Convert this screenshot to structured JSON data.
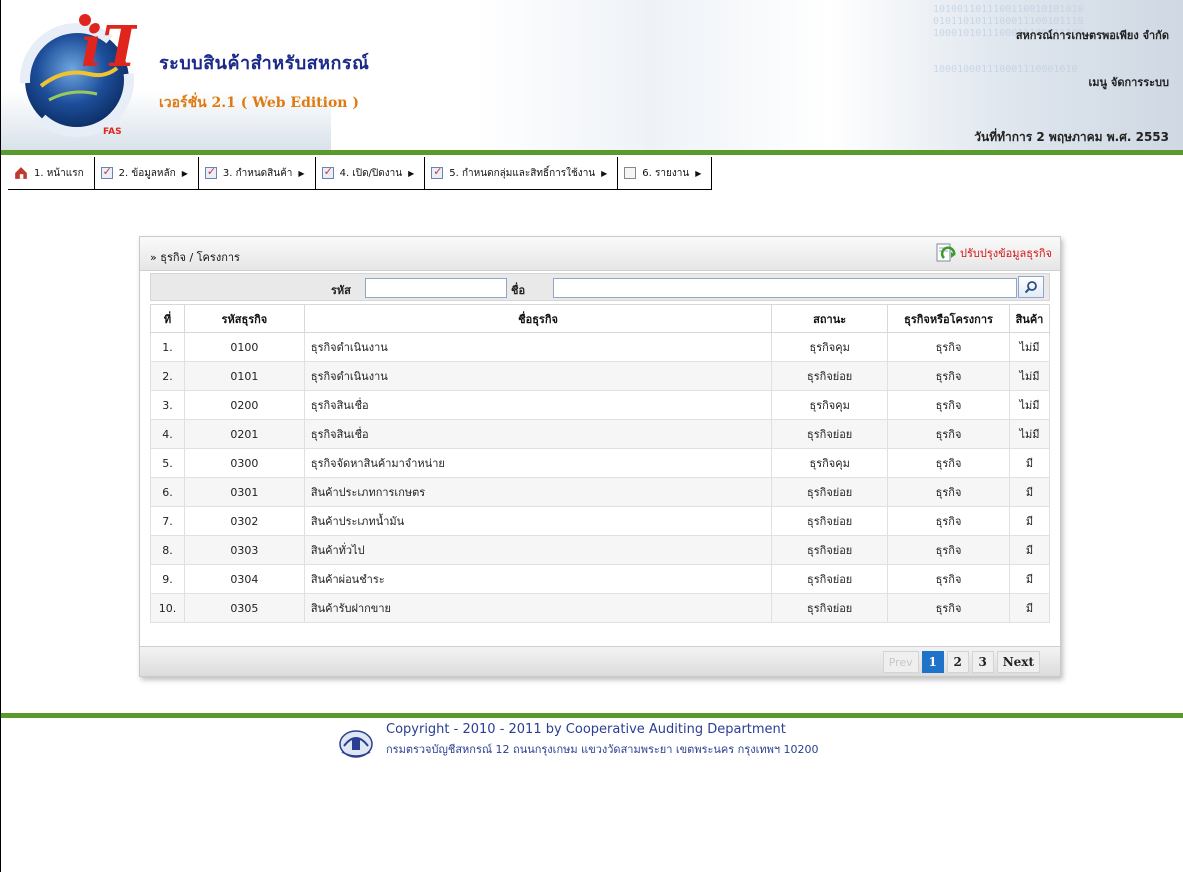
{
  "header": {
    "app_title": "ระบบสินค้าสำหรับสหกรณ์",
    "app_version": "เวอร์ชั่น 2.1 ( Web Edition )",
    "logo_text": "iT",
    "logo_ring_text": "Full Pack Accounting Software : FAS",
    "org_name": "สหกรณ์การเกษตรพอเพียง จำกัด",
    "menu_label": "เมนู จัดการระบบ",
    "work_date": "วันที่ทำการ 2 พฤษภาคม พ.ศ. 2553"
  },
  "nav": {
    "items": [
      {
        "label": "1. หน้าแรก",
        "icon": "home-icon",
        "has_submenu": false
      },
      {
        "label": "2. ข้อมูลหลัก",
        "icon": "checkbox-icon",
        "has_submenu": true
      },
      {
        "label": "3. กำหนดสินค้า",
        "icon": "checkbox-icon",
        "has_submenu": true
      },
      {
        "label": "4. เปิด/ปิดงาน",
        "icon": "checkbox-icon",
        "has_submenu": true
      },
      {
        "label": "5. กำหนดกลุ่มและสิทธิ์การใช้งาน",
        "icon": "checkbox-icon",
        "has_submenu": true
      },
      {
        "label": "6. รายงาน",
        "icon": "document-icon",
        "has_submenu": true
      }
    ]
  },
  "panel": {
    "title": "» ธุรกิจ / โครงการ",
    "update_link": "ปรับปรุงข้อมูลธุรกิจ",
    "search": {
      "code_label": "รหัส",
      "code_value": "",
      "name_label": "ชื่อ",
      "name_value": ""
    },
    "table": {
      "headers": [
        "ที่",
        "รหัสธุรกิจ",
        "ชื่อธุรกิจ",
        "สถานะ",
        "ธุรกิจหรือโครงการ",
        "สินค้า"
      ],
      "rows": [
        [
          "1.",
          "0100",
          "ธุรกิจดำเนินงาน",
          "ธุรกิจคุม",
          "ธุรกิจ",
          "ไม่มี"
        ],
        [
          "2.",
          "0101",
          "ธุรกิจดำเนินงาน",
          "ธุรกิจย่อย",
          "ธุรกิจ",
          "ไม่มี"
        ],
        [
          "3.",
          "0200",
          "ธุรกิจสินเชื่อ",
          "ธุรกิจคุม",
          "ธุรกิจ",
          "ไม่มี"
        ],
        [
          "4.",
          "0201",
          "ธุรกิจสินเชื่อ",
          "ธุรกิจย่อย",
          "ธุรกิจ",
          "ไม่มี"
        ],
        [
          "5.",
          "0300",
          "ธุรกิจจัดหาสินค้ามาจำหน่าย",
          "ธุรกิจคุม",
          "ธุรกิจ",
          "มี"
        ],
        [
          "6.",
          "0301",
          "สินค้าประเภทการเกษตร",
          "ธุรกิจย่อย",
          "ธุรกิจ",
          "มี"
        ],
        [
          "7.",
          "0302",
          "สินค้าประเภทน้ำมัน",
          "ธุรกิจย่อย",
          "ธุรกิจ",
          "มี"
        ],
        [
          "8.",
          "0303",
          "สินค้าทั่วไป",
          "ธุรกิจย่อย",
          "ธุรกิจ",
          "มี"
        ],
        [
          "9.",
          "0304",
          "สินค้าผ่อนชำระ",
          "ธุรกิจย่อย",
          "ธุรกิจ",
          "มี"
        ],
        [
          "10.",
          "0305",
          "สินค้ารับฝากขาย",
          "ธุรกิจย่อย",
          "ธุรกิจ",
          "มี"
        ]
      ]
    },
    "pager": {
      "prev": "Prev",
      "pages": [
        "1",
        "2",
        "3"
      ],
      "current": "1",
      "next": "Next"
    }
  },
  "footer": {
    "copyright": "Copyright - 2010 - 2011  by Cooperative Auditing Department",
    "address": "กรมตรวจบัญชีสหกรณ์ 12 ถนนกรุงเกษม แขวงวัดสามพระยา เขตพระนคร กรุงเทพฯ 10200"
  },
  "colors": {
    "title_blue": "#1b2a8a",
    "version_orange": "#e07a10",
    "green_bar": "#5a9a2c",
    "link_red": "#d41414",
    "active_page": "#1e73c9"
  }
}
